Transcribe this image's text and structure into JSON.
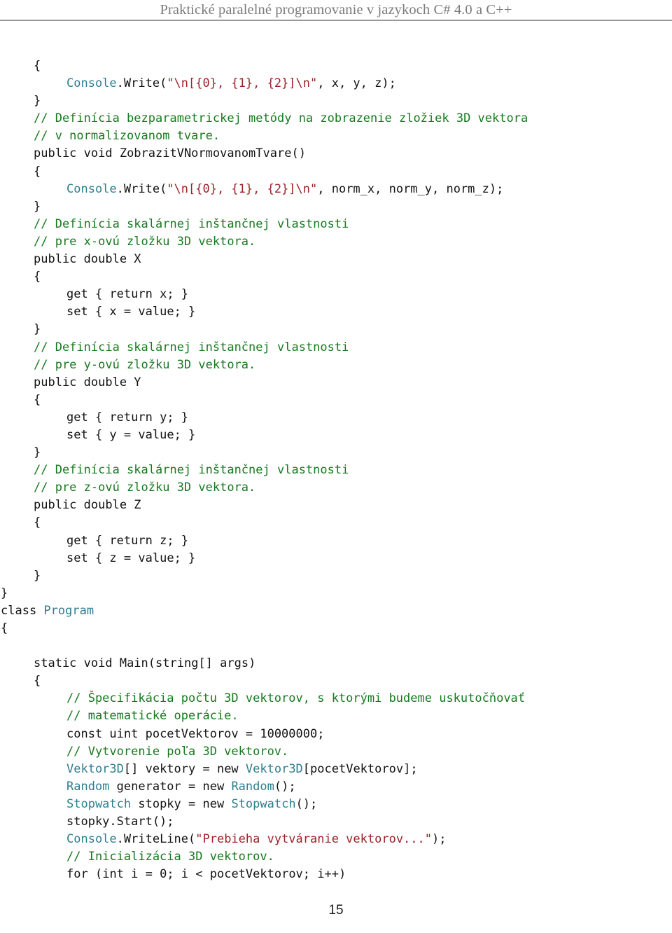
{
  "header": {
    "title": "Praktické paralelné programovanie v jazykoch C# 4.0 a C++",
    "rule_color": "#9a9a9a",
    "title_color": "#7b7b7b"
  },
  "footer": {
    "page_number": "15"
  },
  "syntax_colors": {
    "plain": "#131313",
    "keyword": "#1f1fbe",
    "type": "#2e7d8e",
    "comment": "#17791f",
    "string": "#9b2226"
  },
  "code": {
    "language": "csharp",
    "lines": [
      {
        "indent": 0,
        "tokens": [
          {
            "t": "{",
            "c": "plain"
          }
        ]
      },
      {
        "indent": 1,
        "tokens": [
          {
            "t": "Console",
            "c": "type"
          },
          {
            "t": ".Write(",
            "c": "plain"
          },
          {
            "t": "\"\\n[{0}, {1}, {2}]\\n\"",
            "c": "string"
          },
          {
            "t": ", x, y, z);",
            "c": "plain"
          }
        ]
      },
      {
        "indent": 0,
        "tokens": [
          {
            "t": "}",
            "c": "plain"
          }
        ]
      },
      {
        "indent": 0,
        "tokens": [
          {
            "t": "// Definícia bezparametrickej metódy na zobrazenie zložiek 3D vektora",
            "c": "comment"
          }
        ]
      },
      {
        "indent": 0,
        "tokens": [
          {
            "t": "// v normalizovanom tvare.",
            "c": "comment"
          }
        ]
      },
      {
        "indent": 0,
        "tokens": [
          {
            "t": "public void ",
            "c": "keyword"
          },
          {
            "t": "ZobrazitVNormovanomTvare()",
            "c": "plain"
          }
        ]
      },
      {
        "indent": 0,
        "tokens": [
          {
            "t": "{",
            "c": "plain"
          }
        ]
      },
      {
        "indent": 1,
        "tokens": [
          {
            "t": "Console",
            "c": "type"
          },
          {
            "t": ".Write(",
            "c": "plain"
          },
          {
            "t": "\"\\n[{0}, {1}, {2}]\\n\"",
            "c": "string"
          },
          {
            "t": ", norm_x, norm_y, norm_z);",
            "c": "plain"
          }
        ]
      },
      {
        "indent": 0,
        "tokens": [
          {
            "t": "}",
            "c": "plain"
          }
        ]
      },
      {
        "indent": 0,
        "tokens": [
          {
            "t": "// Definícia skalárnej inštančnej vlastnosti",
            "c": "comment"
          }
        ]
      },
      {
        "indent": 0,
        "tokens": [
          {
            "t": "// pre x-ovú zložku 3D vektora.",
            "c": "comment"
          }
        ]
      },
      {
        "indent": 0,
        "tokens": [
          {
            "t": "public double ",
            "c": "keyword"
          },
          {
            "t": "X",
            "c": "plain"
          }
        ]
      },
      {
        "indent": 0,
        "tokens": [
          {
            "t": "{",
            "c": "plain"
          }
        ]
      },
      {
        "indent": 1,
        "tokens": [
          {
            "t": "get",
            "c": "keyword"
          },
          {
            "t": " { ",
            "c": "plain"
          },
          {
            "t": "return",
            "c": "keyword"
          },
          {
            "t": " x; }",
            "c": "plain"
          }
        ]
      },
      {
        "indent": 1,
        "tokens": [
          {
            "t": "set",
            "c": "keyword"
          },
          {
            "t": " { x = ",
            "c": "plain"
          },
          {
            "t": "value",
            "c": "keyword"
          },
          {
            "t": "; }",
            "c": "plain"
          }
        ]
      },
      {
        "indent": 0,
        "tokens": [
          {
            "t": "}",
            "c": "plain"
          }
        ]
      },
      {
        "indent": 0,
        "tokens": [
          {
            "t": "// Definícia skalárnej inštančnej vlastnosti",
            "c": "comment"
          }
        ]
      },
      {
        "indent": 0,
        "tokens": [
          {
            "t": "// pre y-ovú zložku 3D vektora.",
            "c": "comment"
          }
        ]
      },
      {
        "indent": 0,
        "tokens": [
          {
            "t": "public double ",
            "c": "keyword"
          },
          {
            "t": "Y",
            "c": "plain"
          }
        ]
      },
      {
        "indent": 0,
        "tokens": [
          {
            "t": "{",
            "c": "plain"
          }
        ]
      },
      {
        "indent": 1,
        "tokens": [
          {
            "t": "get",
            "c": "keyword"
          },
          {
            "t": " { ",
            "c": "plain"
          },
          {
            "t": "return",
            "c": "keyword"
          },
          {
            "t": " y; }",
            "c": "plain"
          }
        ]
      },
      {
        "indent": 1,
        "tokens": [
          {
            "t": "set",
            "c": "keyword"
          },
          {
            "t": " { y = ",
            "c": "plain"
          },
          {
            "t": "value",
            "c": "keyword"
          },
          {
            "t": "; }",
            "c": "plain"
          }
        ]
      },
      {
        "indent": 0,
        "tokens": [
          {
            "t": "}",
            "c": "plain"
          }
        ]
      },
      {
        "indent": 0,
        "tokens": [
          {
            "t": "// Definícia skalárnej inštančnej vlastnosti",
            "c": "comment"
          }
        ]
      },
      {
        "indent": 0,
        "tokens": [
          {
            "t": "// pre z-ovú zložku 3D vektora.",
            "c": "comment"
          }
        ]
      },
      {
        "indent": 0,
        "tokens": [
          {
            "t": "public double ",
            "c": "keyword"
          },
          {
            "t": "Z",
            "c": "plain"
          }
        ]
      },
      {
        "indent": 0,
        "tokens": [
          {
            "t": "{",
            "c": "plain"
          }
        ]
      },
      {
        "indent": 1,
        "tokens": [
          {
            "t": "get",
            "c": "keyword"
          },
          {
            "t": " { ",
            "c": "plain"
          },
          {
            "t": "return",
            "c": "keyword"
          },
          {
            "t": " z; }",
            "c": "plain"
          }
        ]
      },
      {
        "indent": 1,
        "tokens": [
          {
            "t": "set",
            "c": "keyword"
          },
          {
            "t": " { z = ",
            "c": "plain"
          },
          {
            "t": "value",
            "c": "keyword"
          },
          {
            "t": "; }",
            "c": "plain"
          }
        ]
      },
      {
        "indent": 0,
        "tokens": [
          {
            "t": "}",
            "c": "plain"
          }
        ]
      },
      {
        "indent": -1,
        "tokens": [
          {
            "t": "}",
            "c": "plain"
          }
        ]
      },
      {
        "indent": -1,
        "tokens": [
          {
            "t": "class ",
            "c": "keyword"
          },
          {
            "t": "Program",
            "c": "type"
          }
        ]
      },
      {
        "indent": -1,
        "tokens": [
          {
            "t": "{",
            "c": "plain"
          }
        ]
      },
      {
        "indent": 0,
        "tokens": [
          {
            "t": "",
            "c": "plain"
          }
        ]
      },
      {
        "indent": 0,
        "tokens": [
          {
            "t": "static void ",
            "c": "keyword"
          },
          {
            "t": "Main(",
            "c": "plain"
          },
          {
            "t": "string",
            "c": "keyword"
          },
          {
            "t": "[] args)",
            "c": "plain"
          }
        ]
      },
      {
        "indent": 0,
        "tokens": [
          {
            "t": "{",
            "c": "plain"
          }
        ]
      },
      {
        "indent": 1,
        "tokens": [
          {
            "t": "// Špecifikácia počtu 3D vektorov, s ktorými budeme uskutočňovať",
            "c": "comment"
          }
        ]
      },
      {
        "indent": 1,
        "tokens": [
          {
            "t": "// matematické operácie.",
            "c": "comment"
          }
        ]
      },
      {
        "indent": 1,
        "tokens": [
          {
            "t": "const uint ",
            "c": "keyword"
          },
          {
            "t": "pocetVektorov = 10000000;",
            "c": "plain"
          }
        ]
      },
      {
        "indent": 1,
        "tokens": [
          {
            "t": "// Vytvorenie poľa 3D vektorov.",
            "c": "comment"
          }
        ]
      },
      {
        "indent": 1,
        "tokens": [
          {
            "t": "Vektor3D",
            "c": "type"
          },
          {
            "t": "[] vektory = ",
            "c": "plain"
          },
          {
            "t": "new ",
            "c": "keyword"
          },
          {
            "t": "Vektor3D",
            "c": "type"
          },
          {
            "t": "[pocetVektorov];",
            "c": "plain"
          }
        ]
      },
      {
        "indent": 1,
        "tokens": [
          {
            "t": "Random",
            "c": "type"
          },
          {
            "t": " generator = ",
            "c": "plain"
          },
          {
            "t": "new ",
            "c": "keyword"
          },
          {
            "t": "Random",
            "c": "type"
          },
          {
            "t": "();",
            "c": "plain"
          }
        ]
      },
      {
        "indent": 1,
        "tokens": [
          {
            "t": "Stopwatch",
            "c": "type"
          },
          {
            "t": " stopky = ",
            "c": "plain"
          },
          {
            "t": "new ",
            "c": "keyword"
          },
          {
            "t": "Stopwatch",
            "c": "type"
          },
          {
            "t": "();",
            "c": "plain"
          }
        ]
      },
      {
        "indent": 1,
        "tokens": [
          {
            "t": "stopky.Start();",
            "c": "plain"
          }
        ]
      },
      {
        "indent": 1,
        "tokens": [
          {
            "t": "Console",
            "c": "type"
          },
          {
            "t": ".WriteLine(",
            "c": "plain"
          },
          {
            "t": "\"Prebieha vytváranie vektorov...\"",
            "c": "string"
          },
          {
            "t": ");",
            "c": "plain"
          }
        ]
      },
      {
        "indent": 1,
        "tokens": [
          {
            "t": "// Inicializácia 3D vektorov.",
            "c": "comment"
          }
        ]
      },
      {
        "indent": 1,
        "tokens": [
          {
            "t": "for ",
            "c": "keyword"
          },
          {
            "t": "(",
            "c": "plain"
          },
          {
            "t": "int",
            "c": "keyword"
          },
          {
            "t": " i = 0; i < pocetVektorov; i++)",
            "c": "plain"
          }
        ]
      }
    ]
  }
}
